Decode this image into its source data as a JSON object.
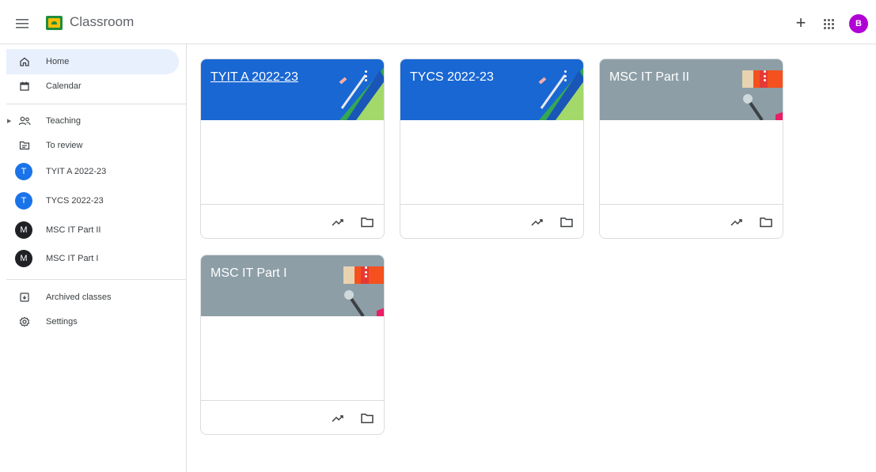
{
  "app": {
    "title": "Classroom",
    "avatar_letter": "B",
    "avatar_color": "#b000d6"
  },
  "header_icons": [
    "menu-icon",
    "classroom-logo-icon",
    "plus-icon",
    "apps-grid-icon",
    "account-avatar"
  ],
  "sidebar": {
    "primary": [
      {
        "label": "Home",
        "icon": "home-icon",
        "active": true
      },
      {
        "label": "Calendar",
        "icon": "calendar-icon"
      }
    ],
    "teaching": {
      "label": "Teaching",
      "icon": "people-icon"
    },
    "to_review": {
      "label": "To review",
      "icon": "review-icon"
    },
    "classes": [
      {
        "label": "TYIT A 2022-23",
        "letter": "T",
        "color": "#1a73e8"
      },
      {
        "label": "TYCS 2022-23",
        "letter": "T",
        "color": "#1a73e8"
      },
      {
        "label": "MSC IT Part II",
        "letter": "M",
        "color": "#202124"
      },
      {
        "label": "MSC IT Part I",
        "letter": "M",
        "color": "#202124"
      }
    ],
    "archived": {
      "label": "Archived classes",
      "icon": "archive-icon"
    },
    "settings": {
      "label": "Settings",
      "icon": "gear-icon"
    }
  },
  "cards": [
    {
      "title": "TYIT A 2022-23",
      "theme": "blue",
      "color": "#1967d2",
      "underlined": true
    },
    {
      "title": "TYCS 2022-23",
      "theme": "blue",
      "color": "#1967d2",
      "underlined": false
    },
    {
      "title": "MSC IT Part II",
      "theme": "grey",
      "color": "#8d9ea7",
      "underlined": false
    },
    {
      "title": "MSC IT Part I",
      "theme": "grey",
      "color": "#8d9ea7",
      "underlined": false
    }
  ],
  "card_footer_icons": [
    "trending-icon",
    "folder-icon"
  ]
}
